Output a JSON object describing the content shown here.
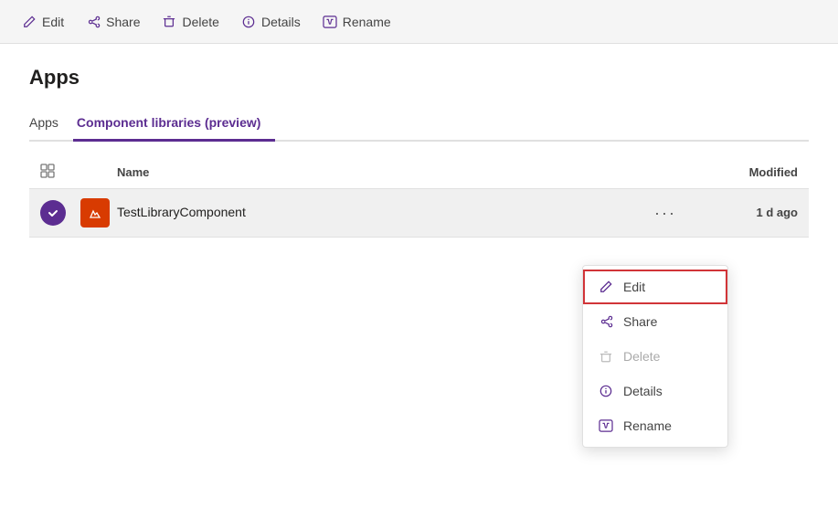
{
  "toolbar": {
    "items": [
      {
        "id": "edit",
        "label": "Edit",
        "icon": "pencil"
      },
      {
        "id": "share",
        "label": "Share",
        "icon": "share"
      },
      {
        "id": "delete",
        "label": "Delete",
        "icon": "trash"
      },
      {
        "id": "details",
        "label": "Details",
        "icon": "info"
      },
      {
        "id": "rename",
        "label": "Rename",
        "icon": "rename"
      }
    ]
  },
  "page": {
    "title": "Apps"
  },
  "tabs": [
    {
      "id": "apps",
      "label": "Apps",
      "active": false
    },
    {
      "id": "component-libraries",
      "label": "Component libraries (preview)",
      "active": true
    }
  ],
  "table": {
    "headers": {
      "name": "Name",
      "modified": "Modified"
    },
    "rows": [
      {
        "id": "testlibrarycomponent",
        "name": "TestLibraryComponent",
        "modified": "1 d ago"
      }
    ]
  },
  "context_menu": {
    "items": [
      {
        "id": "edit",
        "label": "Edit",
        "icon": "pencil",
        "disabled": false,
        "highlighted": true
      },
      {
        "id": "share",
        "label": "Share",
        "icon": "share",
        "disabled": false,
        "highlighted": false
      },
      {
        "id": "delete",
        "label": "Delete",
        "icon": "trash",
        "disabled": true,
        "highlighted": false
      },
      {
        "id": "details",
        "label": "Details",
        "icon": "info",
        "disabled": false,
        "highlighted": false
      },
      {
        "id": "rename",
        "label": "Rename",
        "icon": "rename",
        "disabled": false,
        "highlighted": false
      }
    ]
  }
}
